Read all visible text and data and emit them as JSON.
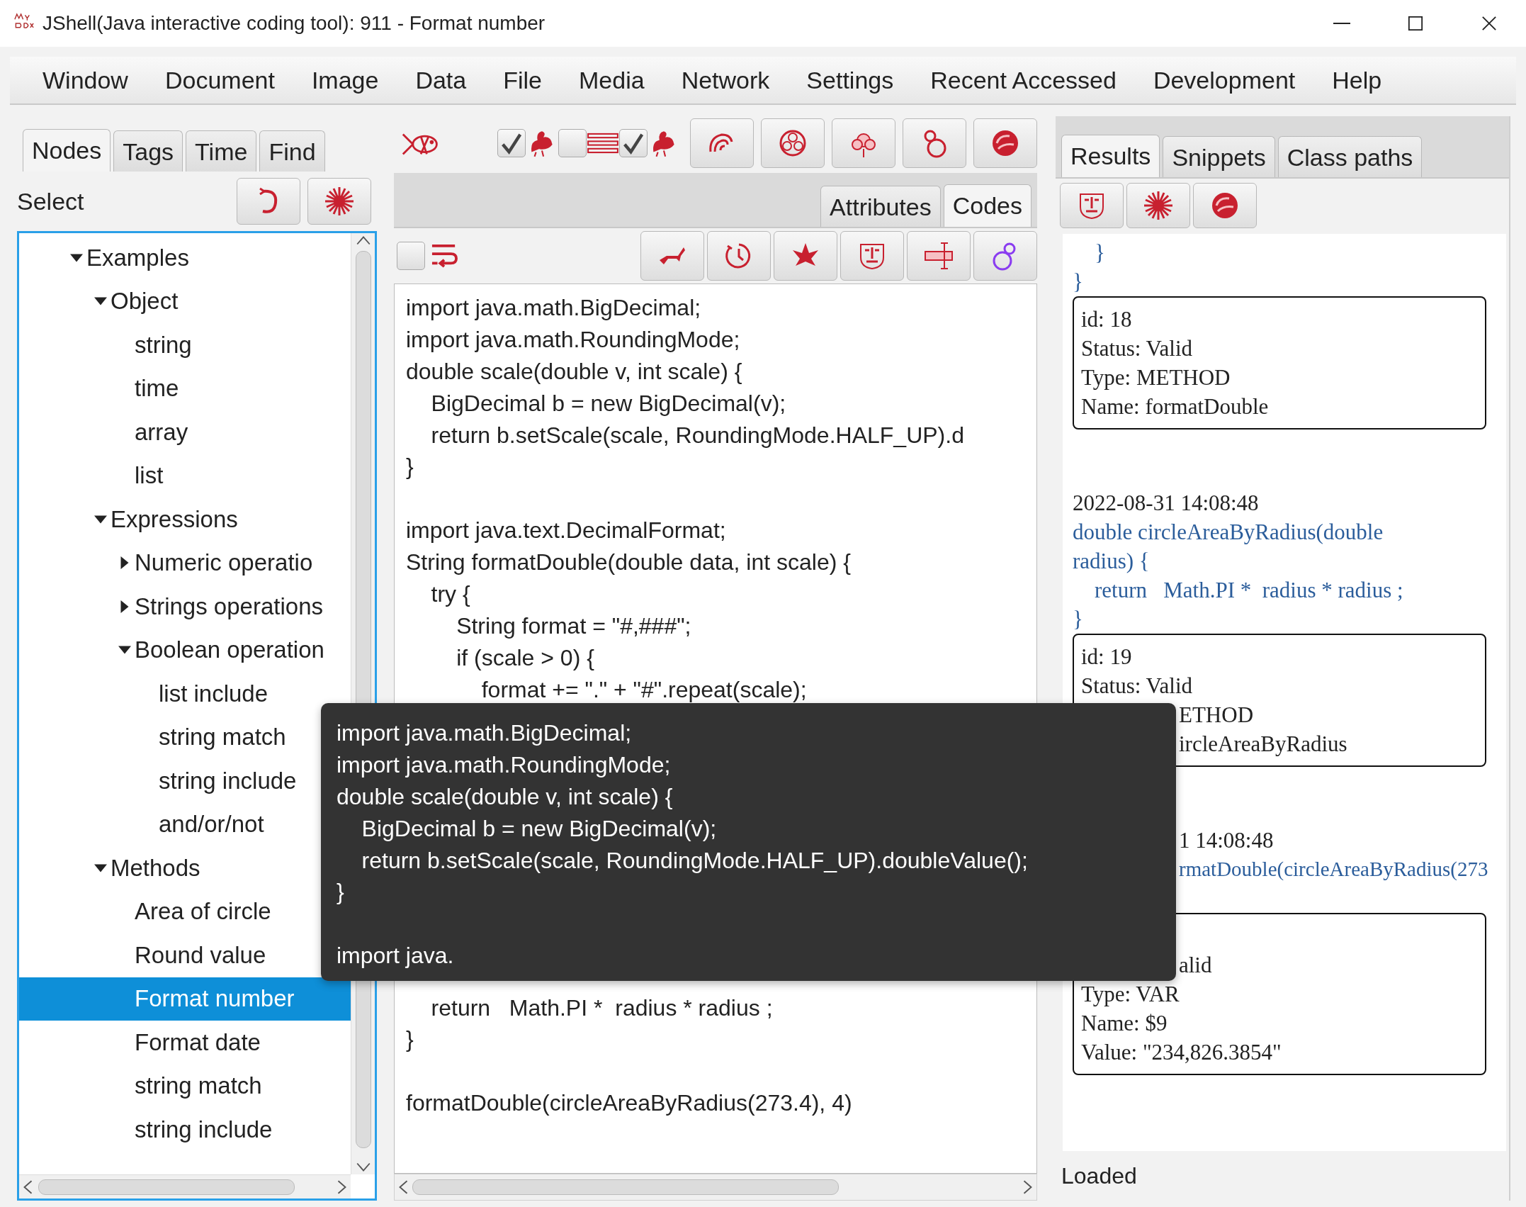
{
  "window": {
    "title": "JShell(Java interactive coding tool): 911 - Format number"
  },
  "menu": [
    "Window",
    "Document",
    "Image",
    "Data",
    "File",
    "Media",
    "Network",
    "Settings",
    "Recent Accessed",
    "Development",
    "Help"
  ],
  "left_panel": {
    "tabs": [
      {
        "label": "Nodes",
        "selected": true
      },
      {
        "label": "Tags",
        "selected": false
      },
      {
        "label": "Time",
        "selected": false
      },
      {
        "label": "Find",
        "selected": false
      }
    ],
    "select_label": "Select",
    "tree": [
      {
        "label": "Examples",
        "expanded": true,
        "selected": false,
        "children": [
          {
            "label": "Object",
            "expanded": true,
            "selected": false,
            "children": [
              {
                "label": "string",
                "selected": false
              },
              {
                "label": "time",
                "selected": false
              },
              {
                "label": "array",
                "selected": false
              },
              {
                "label": "list",
                "selected": false
              }
            ]
          },
          {
            "label": "Expressions",
            "expanded": true,
            "selected": false,
            "children": [
              {
                "label": "Numeric operatio",
                "expanded": false,
                "selected": false
              },
              {
                "label": "Strings operations",
                "expanded": false,
                "selected": false
              },
              {
                "label": "Boolean operation",
                "expanded": true,
                "selected": false,
                "children": [
                  {
                    "label": "list include",
                    "selected": false
                  },
                  {
                    "label": "string match",
                    "selected": false
                  },
                  {
                    "label": "string include",
                    "selected": false
                  },
                  {
                    "label": "and/or/not",
                    "selected": false
                  }
                ]
              }
            ]
          },
          {
            "label": "Methods",
            "expanded": true,
            "selected": false,
            "children": [
              {
                "label": "Area of circle",
                "selected": false
              },
              {
                "label": "Round value",
                "selected": false
              },
              {
                "label": "Format number",
                "selected": true
              },
              {
                "label": "Format date",
                "selected": false
              },
              {
                "label": "string match",
                "selected": false
              },
              {
                "label": "string include",
                "selected": false
              }
            ]
          }
        ]
      }
    ]
  },
  "center_panel": {
    "toggles": [
      {
        "checked": true
      },
      {
        "checked": false
      },
      {
        "checked": true
      }
    ],
    "tabs": [
      {
        "label": "Attributes",
        "selected": false
      },
      {
        "label": "Codes",
        "selected": true
      }
    ],
    "wrap_toggle": {
      "checked": false
    },
    "code": [
      [
        "import java.math.BigDecimal;",
        "import java.math.RoundingMode;",
        "double scale(double v, int scale) {",
        "    BigDecimal b = new BigDecimal(v);",
        "    return b.setScale(scale, RoundingMode.HALF_UP).d",
        "}"
      ],
      [
        "import java.text.DecimalFormat;",
        "String formatDouble(double data, int scale) {",
        "    try {",
        "        String format = \"#,###\";",
        "        if (scale > 0) {",
        "            format += \".\" + \"#\".repeat(scale);"
      ]
    ],
    "code_below_tooltip": [
      [
        "    return   Math.PI *  radius * radius ;",
        "}"
      ],
      [
        "formatDouble(circleAreaByRadius(273.4), 4)"
      ]
    ]
  },
  "right_panel": {
    "tabs": [
      {
        "label": "Results",
        "selected": true
      },
      {
        "label": "Snippets",
        "selected": false
      },
      {
        "label": "Class paths",
        "selected": false
      }
    ],
    "results": [
      {
        "code": [
          "    }",
          "}"
        ],
        "card": [
          "id: 18",
          "Status: Valid",
          "Type: METHOD",
          "Name: formatDouble"
        ]
      },
      {
        "time": "2022-08-31 14:08:48",
        "code": [
          "double circleAreaByRadius(double radius) {",
          "    return   Math.PI *  radius * radius ;",
          "}"
        ],
        "card": [
          "id: 19",
          "Status: Valid",
          {
            "text": "ETHOD",
            "covered": true
          },
          {
            "text": "ircleAreaByRadius",
            "covered": true
          }
        ]
      },
      {
        "time": {
          "text": "1 14:08:48",
          "covered": true
        },
        "code": [
          {
            "text": "rmatDouble(circleAreaByRadius(273",
            "covered": true
          }
        ],
        "card": [
          {
            "text": "alid",
            "covered": true
          },
          "Type: VAR",
          "Name: $9",
          "Value: \"234,826.3854\""
        ]
      }
    ],
    "status": "Loaded"
  },
  "tooltip": [
    [
      "import java.math.BigDecimal;",
      "import java.math.RoundingMode;",
      "double scale(double v, int scale) {",
      "    BigDecimal b = new BigDecimal(v);",
      "    return b.setScale(scale, RoundingMode.HALF_UP).doubleValue();",
      "}"
    ],
    [
      "import java."
    ]
  ]
}
